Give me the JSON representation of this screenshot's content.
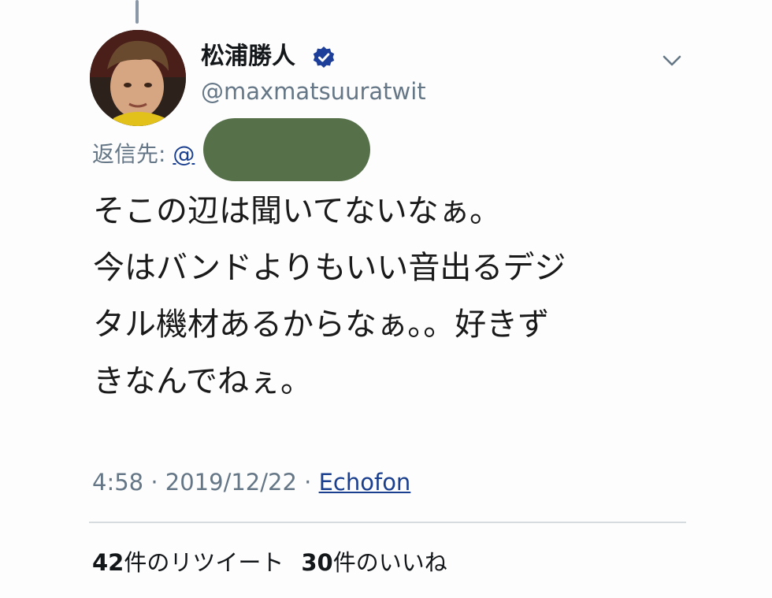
{
  "tweet": {
    "author_name": "松浦勝人",
    "author_handle": "@maxmatsuuratwit",
    "reply_label": "返信先: ",
    "reply_at": "@",
    "body_lines": [
      "そこの辺は聞いてないなぁ。",
      "今はバンドよりもいい音出るデジ",
      "タル機材あるからなぁ。。好きず",
      "きなんでねぇ。"
    ],
    "time": "4:58",
    "separator": " · ",
    "date": "2019/12/22",
    "source": "Echofon",
    "retweet_count": "42",
    "retweet_label": "件のリツイート",
    "like_count": "30",
    "like_label": "件のいいね"
  },
  "icons": {
    "verified": "verified-badge-icon",
    "menu": "chevron-down-icon"
  },
  "colors": {
    "link": "#1b3f8f",
    "secondary_text": "#657786",
    "verified": "#1d3f9a",
    "redaction": "#56704a"
  }
}
